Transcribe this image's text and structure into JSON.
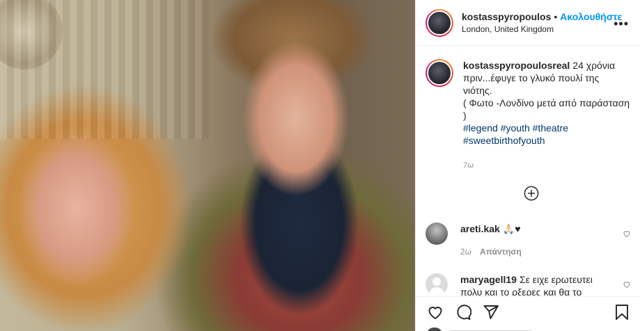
{
  "post": {
    "username": "kostasspyropoulos",
    "separator": "•",
    "follow_label": "Ακολουθήστε",
    "location": "London, United Kingdom",
    "more_label": "•••"
  },
  "caption": {
    "username": "kostasspyropoulosreal",
    "text_1": "24 χρόνια πριν...έφυγε το γλυκό πουλί της νιότης.",
    "text_2": "( Φωτο -Λονδίνο μετά από παράσταση )",
    "hashtags": "#legend #youth #theatre #sweetbirthofyouth",
    "time": "7ω"
  },
  "comments": [
    {
      "username": "areti.kak",
      "text": "🙏🏻♥",
      "time": "2ω",
      "reply_label": "Απάντηση"
    },
    {
      "username": "maryagell19",
      "text": "Σε ειχε ερωτευτει πολυ και το ρξερες και θα το"
    }
  ],
  "icons": {
    "like": "heart-icon",
    "comment": "comment-icon",
    "share": "share-icon",
    "save": "bookmark-icon",
    "add": "add-circle-icon"
  },
  "colors": {
    "follow": "#0095f6",
    "hashtag": "#00376b",
    "muted": "#8e8e8e"
  }
}
